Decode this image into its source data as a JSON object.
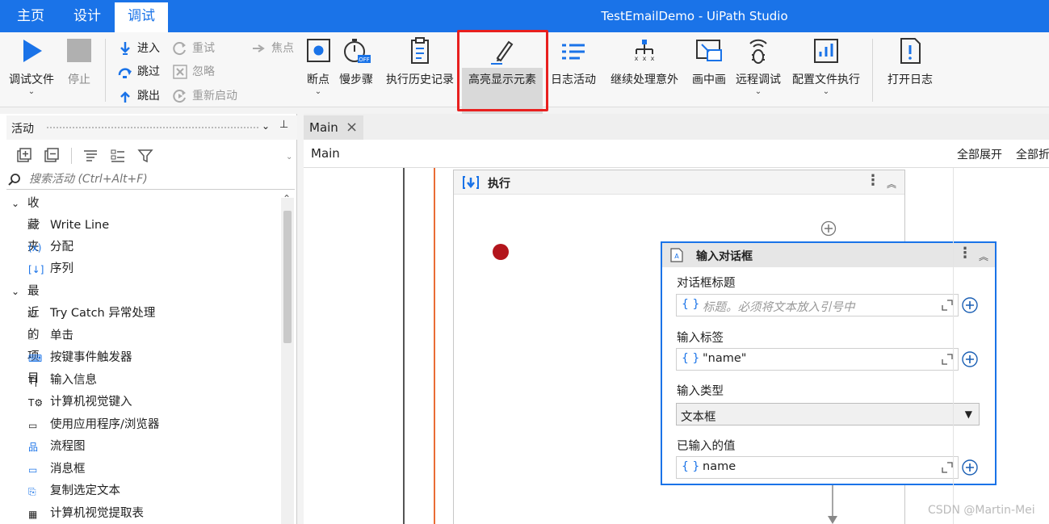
{
  "menu_tabs": [
    {
      "label": "主页",
      "active": false
    },
    {
      "label": "设计",
      "active": false
    },
    {
      "label": "调试",
      "active": true
    }
  ],
  "window_title": "TestEmailDemo - UiPath Studio",
  "ribbon": {
    "debug_file": "调试文件",
    "stop": "停止",
    "step_into": "进入",
    "step_over": "跳过",
    "step_out": "跳出",
    "retry": "重试",
    "ignore": "忽略",
    "restart": "重新启动",
    "focus": "焦点",
    "breakpoints": "断点",
    "slow_step": "慢步骤",
    "exec_history": "执行历史记录",
    "highlight_elements": "高亮显示元素",
    "log_activities": "日志活动",
    "continue_on_exception": "继续处理意外",
    "picture_in_picture": "画中画",
    "remote_debug": "远程调试",
    "profile_execution": "配置文件执行",
    "open_logs": "打开日志"
  },
  "activities_panel": {
    "title": "活动",
    "search_placeholder": "搜索活动 (Ctrl+Alt+F)",
    "groups": [
      {
        "label": "收藏夹",
        "items": [
          "Write Line",
          "分配",
          "序列"
        ]
      },
      {
        "label": "最近的项目",
        "items": [
          "Try Catch 异常处理",
          "单击",
          "按键事件触发器",
          "输入信息",
          "计算机视觉键入",
          "使用应用程序/浏览器",
          "流程图",
          "消息框",
          "复制选定文本",
          "计算机视觉提取表"
        ]
      }
    ]
  },
  "doc_tab": "Main",
  "breadcrumb": "Main",
  "expand_all": "全部展开",
  "collapse_all": "全部折",
  "sequence": {
    "title": "执行"
  },
  "input_dialog": {
    "title": "输入对话框",
    "fields": [
      {
        "label": "对话框标题",
        "value": "",
        "placeholder": "标题。必须将文本放入引号中"
      },
      {
        "label": "输入标签",
        "value": "\"name\""
      },
      {
        "label": "输入类型",
        "value": "文本框"
      },
      {
        "label": "已输入的值",
        "value": "name"
      }
    ]
  },
  "watermark": "CSDN @Martin-Mei",
  "colors": {
    "accent": "#1a73e8",
    "highlight_border": "#e8201f",
    "breakpoint": "#b3151c"
  }
}
